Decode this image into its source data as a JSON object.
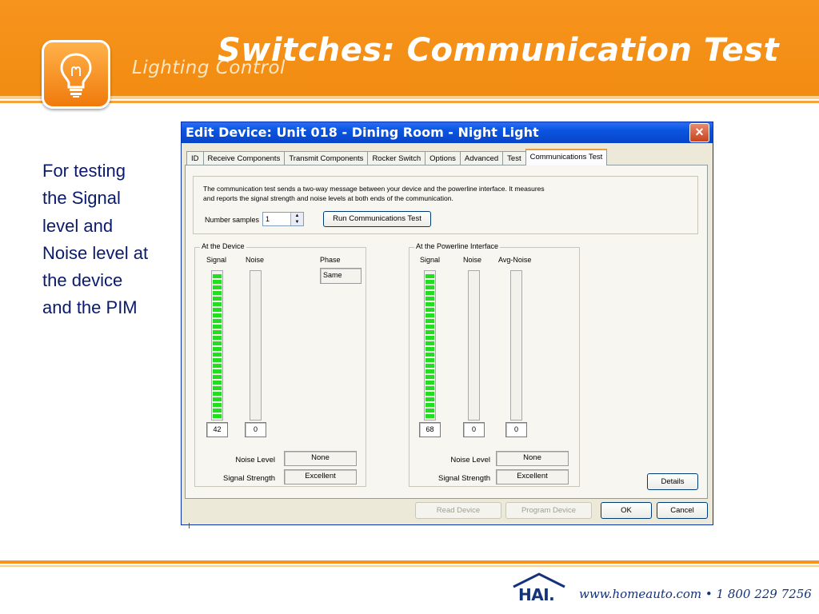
{
  "slide": {
    "brand": "Lighting Control",
    "title": "Switches: Communication Test",
    "body_text": "For testing the Signal level and Noise level at the device and the PIM",
    "footer": {
      "logo_text": "HAI.",
      "contact": "www.homeauto.com • 1 800 229 7256"
    },
    "colors": {
      "header_orange": "#f7941d",
      "body_text_blue": "#0a1a6c",
      "meter_green": "#22dd22"
    }
  },
  "dialog": {
    "title": "Edit Device: Unit 018 - Dining Room - Night Light",
    "close_icon": "×",
    "tabs": [
      {
        "label": "ID"
      },
      {
        "label": "Receive Components"
      },
      {
        "label": "Transmit Components"
      },
      {
        "label": "Rocker Switch"
      },
      {
        "label": "Options"
      },
      {
        "label": "Advanced"
      },
      {
        "label": "Test"
      },
      {
        "label": "Communications Test"
      }
    ],
    "active_tab": "Communications Test",
    "description_line1": "The communication test sends a two-way message between your device and the powerline interface.  It measures",
    "description_line2": "and reports the signal strength and noise levels at both ends of the communication.",
    "number_samples_label": "Number samples",
    "number_samples_value": "1",
    "run_button": "Run Communications Test",
    "device": {
      "group_label": "At the Device",
      "signal_header": "Signal",
      "noise_header": "Noise",
      "phase_header": "Phase",
      "phase_value": "Same",
      "signal_value": "42",
      "noise_value": "0",
      "signal_fill": 1.0,
      "noise_fill": 0.0,
      "noise_level_label": "Noise Level",
      "noise_level_value": "None",
      "signal_strength_label": "Signal Strength",
      "signal_strength_value": "Excellent"
    },
    "pim": {
      "group_label": "At the Powerline Interface",
      "signal_header": "Signal",
      "noise_header": "Noise",
      "avg_noise_header": "Avg-Noise",
      "signal_value": "68",
      "noise_value": "0",
      "avg_noise_value": "0",
      "signal_fill": 1.0,
      "noise_fill": 0.0,
      "avg_noise_fill": 0.0,
      "noise_level_label": "Noise Level",
      "noise_level_value": "None",
      "signal_strength_label": "Signal Strength",
      "signal_strength_value": "Excellent"
    },
    "details_button": "Details",
    "read_device_button": "Read Device",
    "program_device_button": "Program Device",
    "ok_button": "OK",
    "cancel_button": "Cancel"
  }
}
